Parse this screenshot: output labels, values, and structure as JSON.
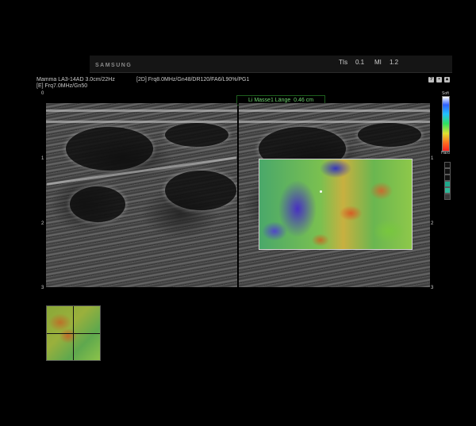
{
  "header": {
    "brand": "SAMSUNG",
    "tis_label": "TIs",
    "tis_value": "0.1",
    "mi_label": "MI",
    "mi_value": "1.2"
  },
  "info": {
    "line1": "Mamma LA3-14AD 3.0cm/22Hz",
    "line2": "[2D] Frq8.0MHz/Gn48/DR120/FA6/L90%/PG1",
    "line3": "[E] Frq7.0MHz/Gn50"
  },
  "toolbar_icons": [
    {
      "name": "help-icon",
      "glyph": "?"
    },
    {
      "name": "lock-icon",
      "glyph": "▪"
    },
    {
      "name": "home-icon",
      "glyph": "▴"
    }
  ],
  "measurement": {
    "label": "Li Masse1 Länge",
    "value": "0.46 cm"
  },
  "depth_scale": [
    "0",
    "1",
    "2",
    "3"
  ],
  "color_bar": {
    "top_label": "Soft",
    "bottom_label": "Hard"
  }
}
